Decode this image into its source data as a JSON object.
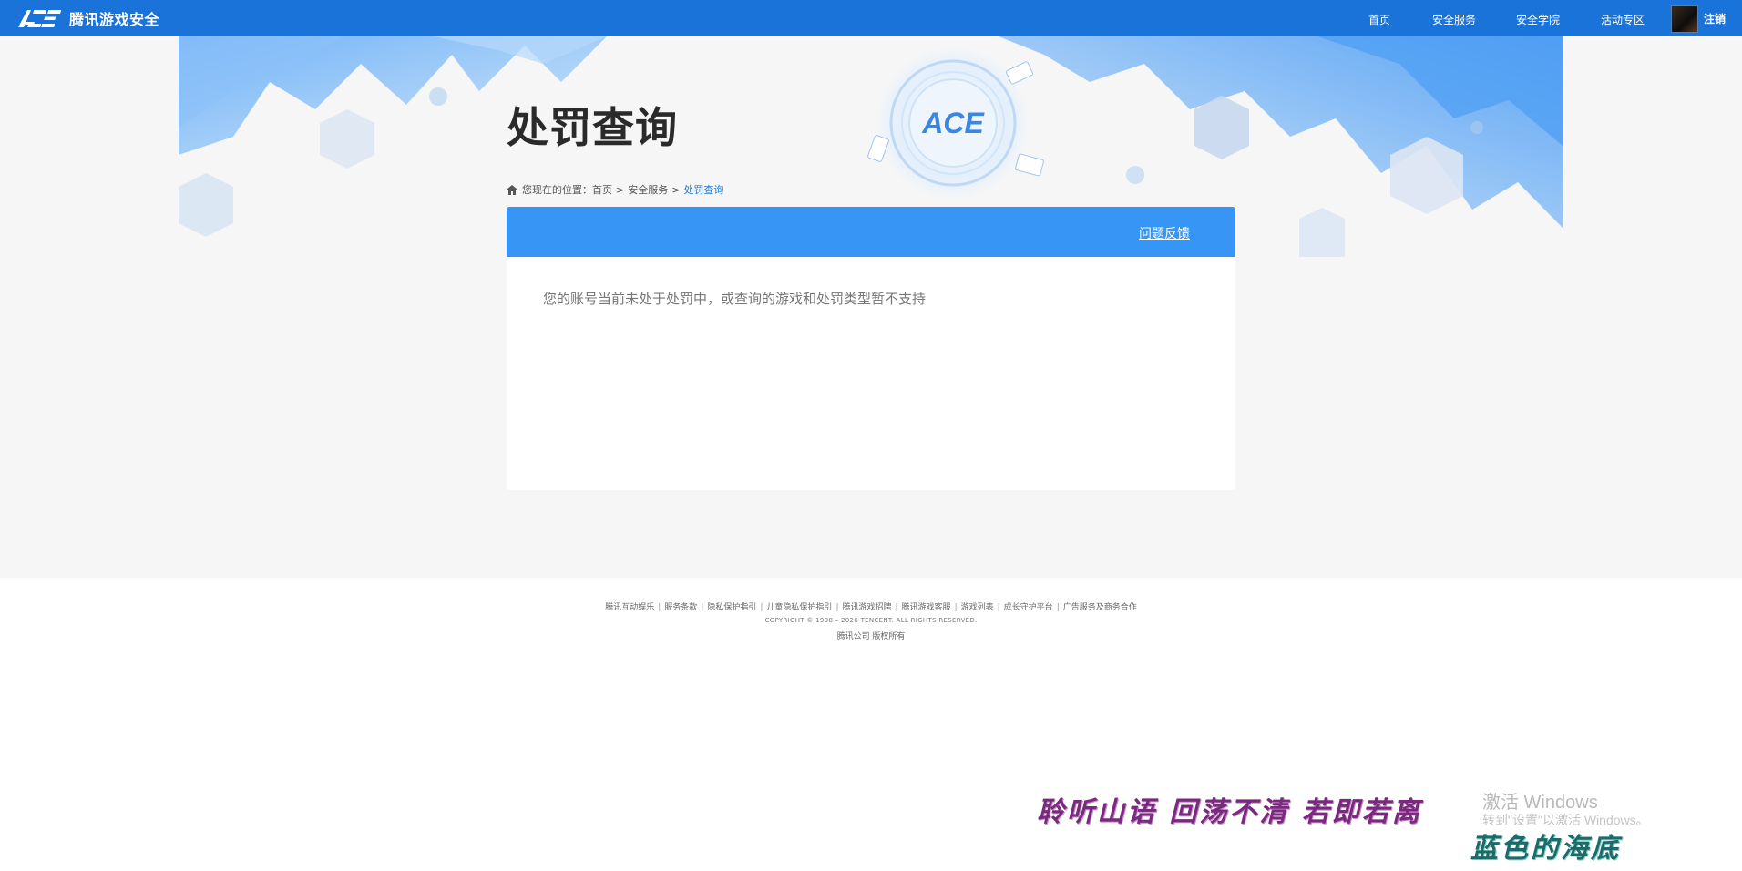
{
  "header": {
    "logo_text": "腾讯游戏安全",
    "nav": [
      "首页",
      "安全服务",
      "安全学院",
      "活动专区"
    ],
    "logout": "注销",
    "bg_color": "#1a73d9"
  },
  "banner": {
    "title": "处罚查询",
    "emblem_text": "ACE"
  },
  "breadcrumb": {
    "prefix": "您现在的位置：",
    "items": [
      "首页",
      "安全服务",
      "处罚查询"
    ],
    "separator": ">"
  },
  "card": {
    "feedback_link": "问题反馈",
    "message": "您的账号当前未处于处罚中，或查询的游戏和处罚类型暂不支持",
    "header_color": "#3795f5"
  },
  "footer": {
    "links": [
      "腾讯互动娱乐",
      "服务条款",
      "隐私保护指引",
      "儿童隐私保护指引",
      "腾讯游戏招聘",
      "腾讯游戏客服",
      "游戏列表",
      "成长守护平台",
      "广告服务及商务合作"
    ],
    "copyright": "COPYRIGHT © 1998 – 2026 TENCENT. ALL RIGHTS RESERVED.",
    "company": "腾讯公司 版权所有"
  },
  "overlay": {
    "poem_line1": "聆听山语 回荡不清 若即若离",
    "poem_line2": "蓝色的海底",
    "windows_activate_title": "激活 Windows",
    "windows_activate_sub": "转到\"设置\"以激活 Windows。"
  }
}
